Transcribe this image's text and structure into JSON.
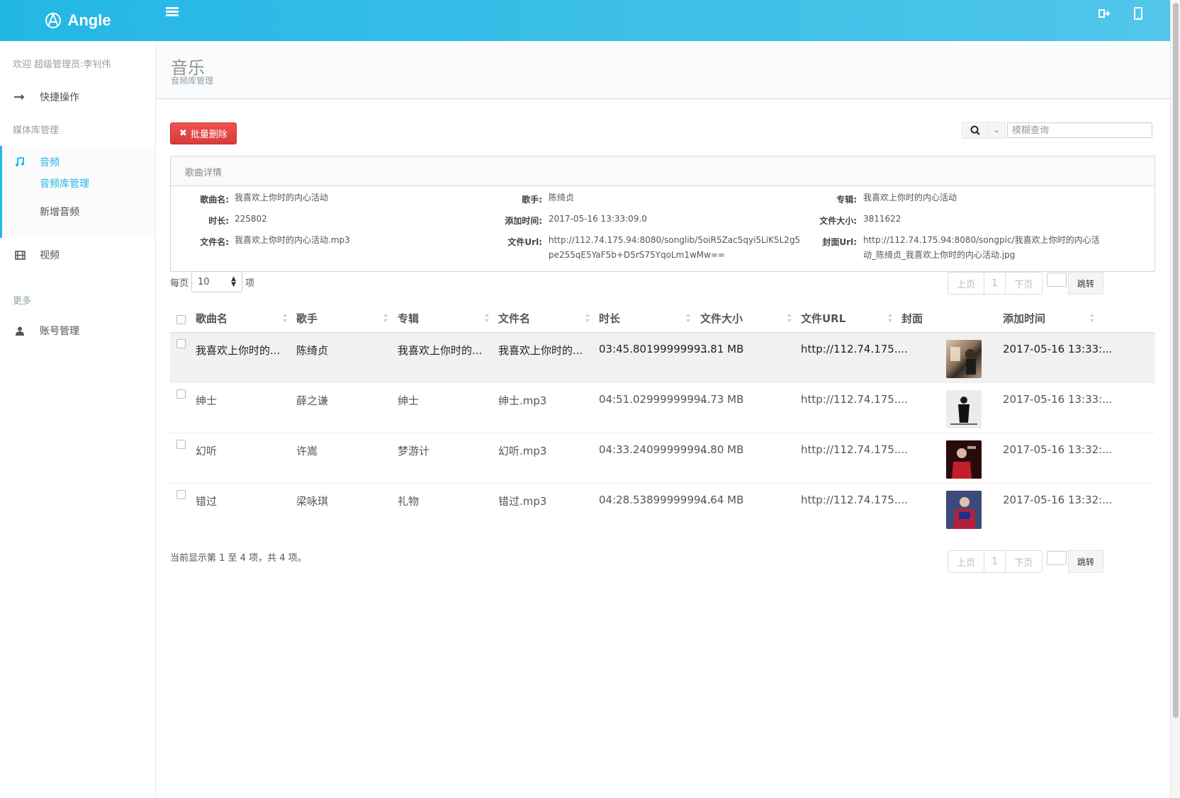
{
  "brand": {
    "name": "Angle"
  },
  "sidebar": {
    "welcome": "欢迎 超级管理员:李钊伟",
    "quick": "快捷操作",
    "media_heading": "媒体库管理",
    "audio": "音频",
    "audio_sub": [
      "音频库管理",
      "新增音频"
    ],
    "video": "视频",
    "more_heading": "更多",
    "account": "账号管理"
  },
  "page": {
    "title": "音乐",
    "subtitle": "音频库管理"
  },
  "toolbar": {
    "batch_delete": "批量删除",
    "search_placeholder": "模糊查询"
  },
  "detail": {
    "header": "歌曲详情",
    "fields": {
      "song_label": "歌曲名:",
      "song": "我喜欢上你时的内心活动",
      "singer_label": "歌手:",
      "singer": "陈绮贞",
      "album_label": "专辑:",
      "album": "我喜欢上你时的内心活动",
      "duration_label": "时长:",
      "duration": "225802",
      "added_label": "添加时间:",
      "added": "2017-05-16 13:33:09.0",
      "size_label": "文件大小:",
      "size": "3811622",
      "filename_label": "文件名:",
      "filename": "我喜欢上你时的内心活动.mp3",
      "fileurl_label": "文件Url:",
      "fileurl_1": "http://112.74.175.94:8080/songlib/5oiR5Zac5qyi5LiK5L2g5",
      "fileurl_2": "pe255qE5YaF5b+D5rS75YqoLm1wMw==",
      "cover_label": "封面Url:",
      "cover_1": "http://112.74.175.94:8080/songpic/我喜欢上你时的内心活",
      "cover_2": "动_陈绮贞_我喜欢上你时的内心活动.jpg"
    }
  },
  "length": {
    "prefix": "每页",
    "value": "10",
    "suffix": "项"
  },
  "pager": {
    "prev": "上页",
    "page": "1",
    "next": "下页",
    "go": "跳转"
  },
  "table": {
    "columns": [
      "歌曲名",
      "歌手",
      "专辑",
      "文件名",
      "时长",
      "文件大小",
      "文件URL",
      "封面",
      "添加时间"
    ],
    "rows": [
      {
        "song": "我喜欢上你时的...",
        "singer": "陈绮贞",
        "album": "我喜欢上你时的...",
        "file": "我喜欢上你时的...",
        "duration": "03:45.8019999999...",
        "size": "3.81 MB",
        "url": "http://112.74.175....",
        "added": "2017-05-16 13:33:..."
      },
      {
        "song": "绅士",
        "singer": "薛之谦",
        "album": "绅士",
        "file": "绅士.mp3",
        "duration": "04:51.0299999999...",
        "size": "4.73 MB",
        "url": "http://112.74.175....",
        "added": "2017-05-16 13:33:..."
      },
      {
        "song": "幻听",
        "singer": "许嵩",
        "album": "梦游计",
        "file": "幻听.mp3",
        "duration": "04:33.2409999999...",
        "size": "4.80 MB",
        "url": "http://112.74.175....",
        "added": "2017-05-16 13:32:..."
      },
      {
        "song": "错过",
        "singer": "梁咏琪",
        "album": "礼物",
        "file": "错过.mp3",
        "duration": "04:28.5389999999...",
        "size": "4.64 MB",
        "url": "http://112.74.175....",
        "added": "2017-05-16 13:32:..."
      }
    ]
  },
  "info": "当前显示第 1 至 4 项，共 4 项。",
  "colors": {
    "accent": "#23b7e5",
    "danger": "#f05050"
  }
}
